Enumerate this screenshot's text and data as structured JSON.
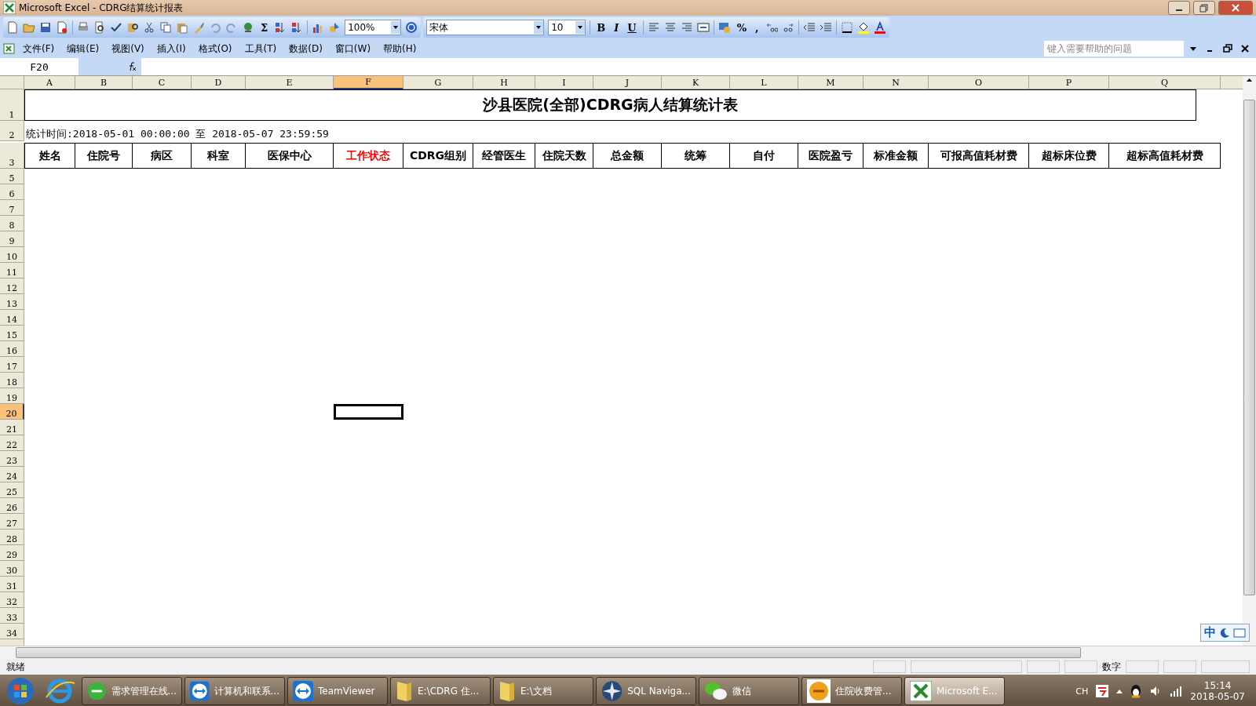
{
  "window": {
    "title": "Microsoft Excel - CDRG结算统计报表"
  },
  "toolbar": {
    "sum": "Σ",
    "zoom": "100%",
    "font": "宋体",
    "size": "10",
    "format_buttons": [
      "B",
      "I",
      "U"
    ],
    "percent": "%",
    "comma": ","
  },
  "menu": [
    "文件(F)",
    "编辑(E)",
    "视图(V)",
    "插入(I)",
    "格式(O)",
    "工具(T)",
    "数据(D)",
    "窗口(W)",
    "帮助(H)"
  ],
  "help": {
    "placeholder": "键入需要帮助的问题"
  },
  "name_box": "F20",
  "columns": [
    {
      "label": "A",
      "selected": false
    },
    {
      "label": "B",
      "selected": false
    },
    {
      "label": "C",
      "selected": false
    },
    {
      "label": "D",
      "selected": false
    },
    {
      "label": "E",
      "selected": false
    },
    {
      "label": "F",
      "selected": true
    },
    {
      "label": "G",
      "selected": false
    },
    {
      "label": "H",
      "selected": false
    },
    {
      "label": "I",
      "selected": false
    },
    {
      "label": "J",
      "selected": false
    },
    {
      "label": "K",
      "selected": false
    },
    {
      "label": "L",
      "selected": false
    },
    {
      "label": "M",
      "selected": false
    },
    {
      "label": "N",
      "selected": false
    },
    {
      "label": "O",
      "selected": false
    },
    {
      "label": "P",
      "selected": false
    },
    {
      "label": "Q",
      "selected": false
    }
  ],
  "rows": [
    {
      "label": "1",
      "selected": false
    },
    {
      "label": "2",
      "selected": false
    },
    {
      "label": "3",
      "selected": false
    },
    {
      "label": "5",
      "selected": false
    },
    {
      "label": "6",
      "selected": false
    },
    {
      "label": "7",
      "selected": false
    },
    {
      "label": "8",
      "selected": false
    },
    {
      "label": "9",
      "selected": false
    },
    {
      "label": "10",
      "selected": false
    },
    {
      "label": "11",
      "selected": false
    },
    {
      "label": "12",
      "selected": false
    },
    {
      "label": "13",
      "selected": false
    },
    {
      "label": "14",
      "selected": false
    },
    {
      "label": "15",
      "selected": false
    },
    {
      "label": "16",
      "selected": false
    },
    {
      "label": "17",
      "selected": false
    },
    {
      "label": "18",
      "selected": false
    },
    {
      "label": "19",
      "selected": false
    },
    {
      "label": "20",
      "selected": true
    },
    {
      "label": "21",
      "selected": false
    },
    {
      "label": "22",
      "selected": false
    },
    {
      "label": "23",
      "selected": false
    },
    {
      "label": "24",
      "selected": false
    },
    {
      "label": "25",
      "selected": false
    },
    {
      "label": "26",
      "selected": false
    },
    {
      "label": "27",
      "selected": false
    },
    {
      "label": "28",
      "selected": false
    },
    {
      "label": "29",
      "selected": false
    },
    {
      "label": "30",
      "selected": false
    },
    {
      "label": "31",
      "selected": false
    },
    {
      "label": "32",
      "selected": false
    },
    {
      "label": "33",
      "selected": false
    },
    {
      "label": "34",
      "selected": false
    }
  ],
  "sheet": {
    "title": "沙县医院(全部)CDRG病人结算统计表",
    "period": "统计时间:2018-05-01 00:00:00 至 2018-05-07 23:59:59",
    "headers": [
      {
        "text": "姓名",
        "color": "#000000"
      },
      {
        "text": "住院号",
        "color": "#000000"
      },
      {
        "text": "病区",
        "color": "#000000"
      },
      {
        "text": "科室",
        "color": "#000000"
      },
      {
        "text": "医保中心",
        "color": "#000000"
      },
      {
        "text": "工作状态",
        "color": "#ff0000"
      },
      {
        "text": "CDRG组别",
        "color": "#000000"
      },
      {
        "text": "经管医生",
        "color": "#000000"
      },
      {
        "text": "住院天数",
        "color": "#000000"
      },
      {
        "text": "总金额",
        "color": "#000000"
      },
      {
        "text": "统筹",
        "color": "#000000"
      },
      {
        "text": "自付",
        "color": "#000000"
      },
      {
        "text": "医院盈亏",
        "color": "#000000"
      },
      {
        "text": "标准金额",
        "color": "#000000"
      },
      {
        "text": "可报高值耗材费",
        "color": "#000000"
      },
      {
        "text": "超标床位费",
        "color": "#000000"
      },
      {
        "text": "超标高值耗材费",
        "color": "#000000"
      }
    ]
  },
  "ime": {
    "label": "中"
  },
  "status": {
    "left": "就绪",
    "indicator": "数字"
  },
  "taskbar": {
    "items": [
      {
        "label": "需求管理在线...",
        "kind": "browser",
        "selected": false
      },
      {
        "label": "计算机和联系...",
        "kind": "remote",
        "selected": false
      },
      {
        "label": "TeamViewer",
        "kind": "remote",
        "selected": false
      },
      {
        "label": "E:\\CDRG 住...",
        "kind": "folder",
        "selected": false
      },
      {
        "label": "E:\\文档",
        "kind": "folder",
        "selected": false
      },
      {
        "label": "SQL Naviga...",
        "kind": "compass",
        "selected": false
      },
      {
        "label": "微信",
        "kind": "chat",
        "selected": false
      },
      {
        "label": "住院收费管...",
        "kind": "app",
        "selected": false
      },
      {
        "label": "Microsoft E...",
        "kind": "sheet",
        "selected": true
      }
    ],
    "tray": {
      "lang": "CH",
      "time": "15:14",
      "date": "2018-05-07"
    }
  }
}
